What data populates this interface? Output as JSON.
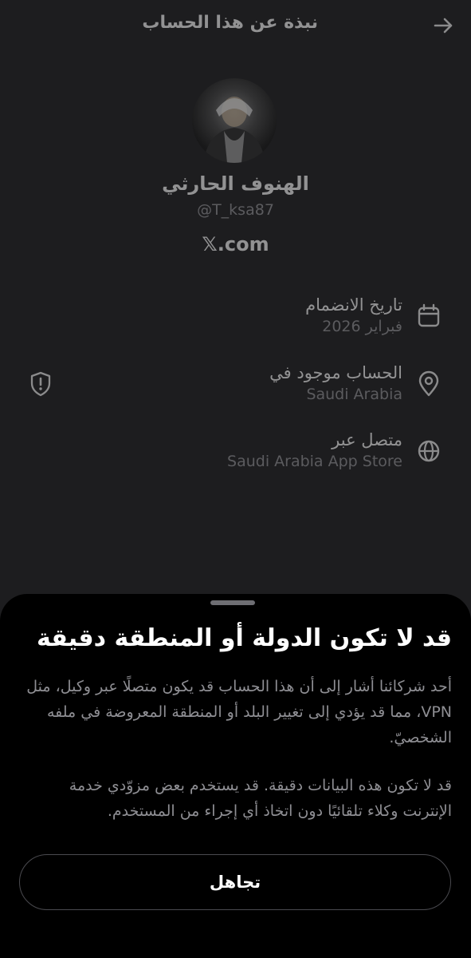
{
  "header": {
    "title": "نبذة عن هذا الحساب"
  },
  "profile": {
    "name": "الهنوف الحارثي",
    "handle": "@T_ksa87",
    "domain": "𝕏.com"
  },
  "info_rows": [
    {
      "label": "تاريخ الانضمام",
      "value": "فبراير 2026",
      "icon": "calendar-icon"
    },
    {
      "label": "الحساب موجود في",
      "value": "Saudi Arabia",
      "icon": "location-pin-icon"
    },
    {
      "label": "متصل عبر",
      "value": "Saudi Arabia App Store",
      "icon": "globe-icon"
    }
  ],
  "sheet": {
    "title": "قد لا تكون الدولة أو المنطقة دقيقة",
    "paragraph1": "أحد شركائنا أشار إلى أن هذا الحساب قد يكون متصلًا عبر وكيل، مثل VPN، مما قد يؤدي إلى تغيير البلد أو المنطقة المعروضة في ملفه الشخصيّ.",
    "paragraph2": "قد لا تكون هذه البيانات دقيقة. قد يستخدم بعض مزوّدي خدمة الإنترنت وكلاء تلقائيًا دون اتخاذ أي إجراء من المستخدم.",
    "dismiss_label": "تجاهل"
  },
  "colors": {
    "background": "#1d1d1f",
    "sheet": "#000000",
    "muted": "#8e8e93"
  }
}
